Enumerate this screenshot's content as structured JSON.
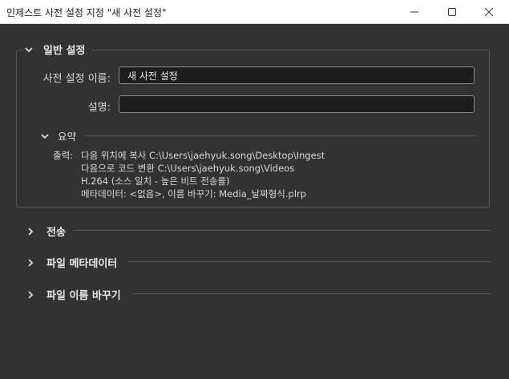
{
  "window": {
    "title": "인제스트 사전 설정 지정 \"새 사전 설정\""
  },
  "general": {
    "header": "일반 설정",
    "preset_name_label": "사전 설정 이름:",
    "preset_name_value": "새 사전 설정",
    "description_label": "설명:",
    "description_value": ""
  },
  "summary": {
    "header": "요약",
    "output_label": "출력:",
    "lines": [
      "다음 위치에 복사 C:\\Users\\jaehyuk.song\\Desktop\\Ingest",
      "다음으로 코드 변환 C:\\Users\\jaehyuk.song\\Videos",
      "H.264 (소스 일치 - 높은 비트 전송률)",
      "메타데이터: <없음>, 이름 바꾸기: Media_날짜형식.plrp"
    ]
  },
  "sections": [
    {
      "label": "전송"
    },
    {
      "label": "파일 메타데이터"
    },
    {
      "label": "파일 이름 바꾸기"
    }
  ],
  "icons": {
    "minimize": "minimize-icon",
    "maximize": "maximize-icon",
    "close": "close-icon",
    "expanded": "chevron-down-icon",
    "collapsed": "chevron-right-icon"
  }
}
